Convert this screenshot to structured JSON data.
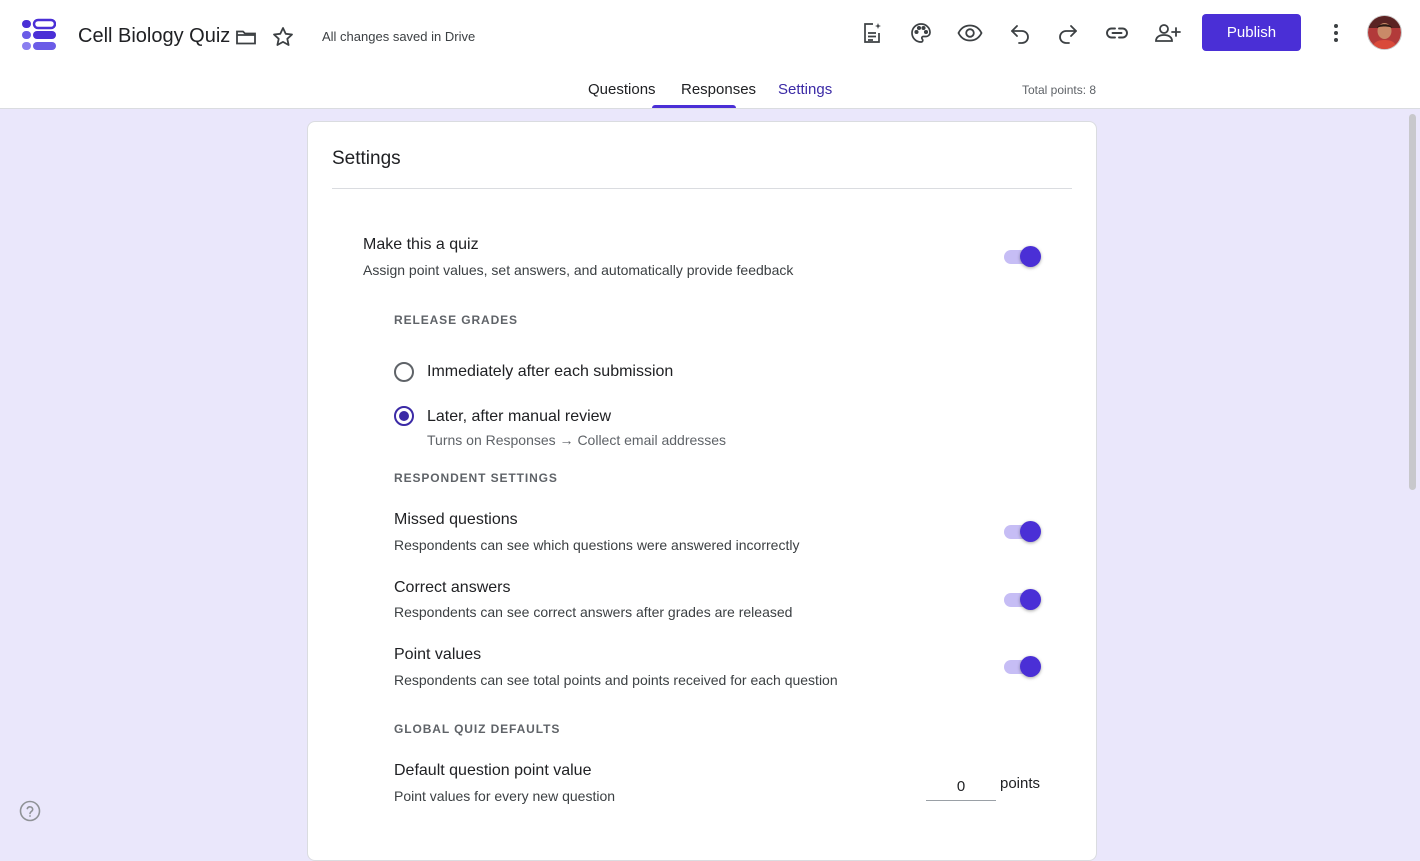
{
  "header": {
    "title": "Cell Biology Quiz",
    "save_status": "All changes saved in Drive",
    "publish_label": "Publish",
    "total_points": "Total points: 8"
  },
  "tabs": [
    {
      "label": "Questions"
    },
    {
      "label": "Responses"
    },
    {
      "label": "Settings"
    }
  ],
  "settings": {
    "title": "Settings",
    "quiz": {
      "title": "Make this a quiz",
      "desc": "Assign point values, set answers, and automatically provide feedback",
      "enabled": true
    },
    "release_grades": {
      "label": "RELEASE GRADES",
      "options": [
        {
          "label": "Immediately after each submission",
          "checked": false
        },
        {
          "label": "Later, after manual review",
          "checked": true,
          "sub": "Turns on Responses → Collect email addresses"
        }
      ]
    },
    "respondent": {
      "label": "RESPONDENT SETTINGS",
      "items": [
        {
          "title": "Missed questions",
          "desc": "Respondents can see which questions were answered incorrectly",
          "enabled": true
        },
        {
          "title": "Correct answers",
          "desc": "Respondents can see correct answers after grades are released",
          "enabled": true
        },
        {
          "title": "Point values",
          "desc": "Respondents can see total points and points received for each question",
          "enabled": true
        }
      ]
    },
    "defaults": {
      "label": "GLOBAL QUIZ DEFAULTS",
      "title": "Default question point value",
      "desc": "Point values for every new question",
      "value": "0",
      "unit": "points"
    }
  },
  "colors": {
    "accent": "#4a2fd6",
    "page_bg": "#eae7fb"
  },
  "icons": [
    "forms-logo-icon",
    "folder-icon",
    "star-icon",
    "ai-summary-icon",
    "palette-icon",
    "preview-eye-icon",
    "undo-icon",
    "redo-icon",
    "link-icon",
    "add-collaborator-icon",
    "more-vert-icon",
    "help-icon"
  ]
}
